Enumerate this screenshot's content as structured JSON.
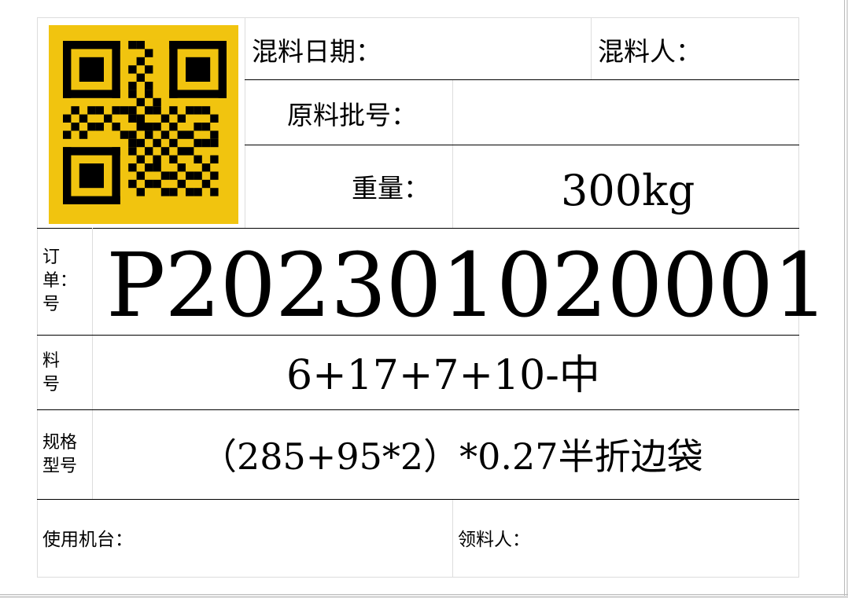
{
  "qr_code": {
    "background_color": "#f1c40f",
    "module_color": "#000000"
  },
  "mixing_date": {
    "label": "混料日期：",
    "value": ""
  },
  "mixer": {
    "label": "混料人：",
    "value": ""
  },
  "raw_batch": {
    "label": "原料批号：",
    "value": ""
  },
  "weight": {
    "label": "重量：",
    "value": "300kg"
  },
  "order": {
    "label_lines": [
      "订",
      "单：",
      "号"
    ],
    "value": "P202301020001"
  },
  "material": {
    "label_lines": [
      "料",
      "号"
    ],
    "value": "6+17+7+10-中"
  },
  "spec": {
    "label_lines": [
      "规格",
      "型号"
    ],
    "value": "（285+95*2）*0.27半折边袋"
  },
  "machine": {
    "label": "使用机台：",
    "value": ""
  },
  "receiver": {
    "label": "领料人：",
    "value": ""
  }
}
